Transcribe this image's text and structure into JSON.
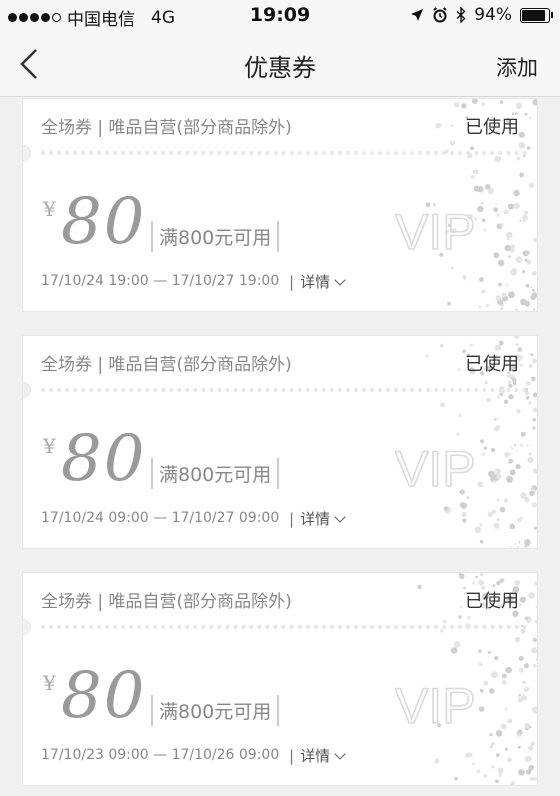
{
  "status_bar": {
    "carrier": "中国电信",
    "network": "4G",
    "time": "19:09",
    "battery": "94%",
    "battery_level": 0.94
  },
  "nav": {
    "title": "优惠券",
    "add_label": "添加"
  },
  "coupons": [
    {
      "scope": "全场券 | 唯品自营(部分商品除外)",
      "status": "已使用",
      "currency": "¥",
      "amount": "80",
      "condition": "满800元可用",
      "logo_text": "VIP",
      "validity": "17/10/24 19:00 — 17/10/27 19:00",
      "detail_label": "详情"
    },
    {
      "scope": "全场券 | 唯品自营(部分商品除外)",
      "status": "已使用",
      "currency": "¥",
      "amount": "80",
      "condition": "满800元可用",
      "logo_text": "VIP",
      "validity": "17/10/24 09:00 — 17/10/27 09:00",
      "detail_label": "详情"
    },
    {
      "scope": "全场券 | 唯品自营(部分商品除外)",
      "status": "已使用",
      "currency": "¥",
      "amount": "80",
      "condition": "满800元可用",
      "logo_text": "VIP",
      "validity": "17/10/23 09:00 — 17/10/26 09:00",
      "detail_label": "详情"
    }
  ],
  "icons": {
    "back": "back-chevron-icon",
    "location": "location-arrow-icon",
    "alarm": "alarm-icon",
    "bluetooth": "bluetooth-icon",
    "battery": "battery-icon",
    "signal": "signal-dots-icon"
  }
}
